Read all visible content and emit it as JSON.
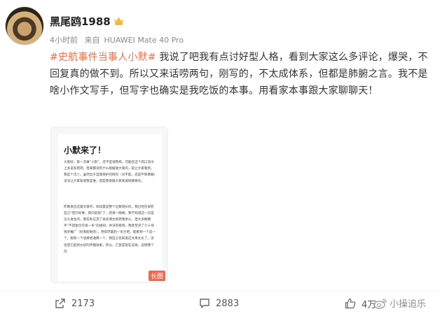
{
  "post": {
    "username": "黑尾鸥1988",
    "time": "4小时前",
    "source_prefix": "来自",
    "device": "HUAWEI Mate 40 Pro",
    "hashtag": "#史航事件当事人小默#",
    "body": " 我说了吧我有点讨好型人格，看到大家这么多评论，爆哭，不回复真的做不到。所以又来话唠两句，刚写的，不太成体系，但都是肺腑之言。我不是啥小作文写手，但写字也确实是我吃饭的本事。用看家本事跟大家聊聊天！"
  },
  "card": {
    "title": "小默来了！",
    "paragraphs": [
      "大家好，第一次做“小默”，还不是很熟练。可能在这个风口浪尖上多说多错吧，但来都没有什么能报偿大家的，就让大家看到，我是个活人，虽然出于自我保护的目的（对不起，还是不够勇敢）没法让大家知道我是谁，但是愿意跟大家真诚地聊聊天。",
      "昨晚发出这篇文章时，阅读量是整个位数增长的，我已经在安慰自己“但行好事，莫问前程”了，结果一睁眼，我不知道这一切是怎么发生的，我在私信求了很多博主帮转我承认，但大多数拥手“不回复仅可发一条”的规则，并没有看到。我甚至赏了六十块钱买推广（好丢脸啦哈），觉得尽最后一份力吧，能看到一个是一个，能帮一个估摸想通算一个，我自己也知道这文章太长了，没指望它起到太好的传播效果，所以，它变成现在这样，说明两个问"
    ],
    "badge": "长图"
  },
  "actions": {
    "reposts": "2173",
    "comments": "2883",
    "likes": "4万"
  },
  "watermark": "小操追乐"
}
